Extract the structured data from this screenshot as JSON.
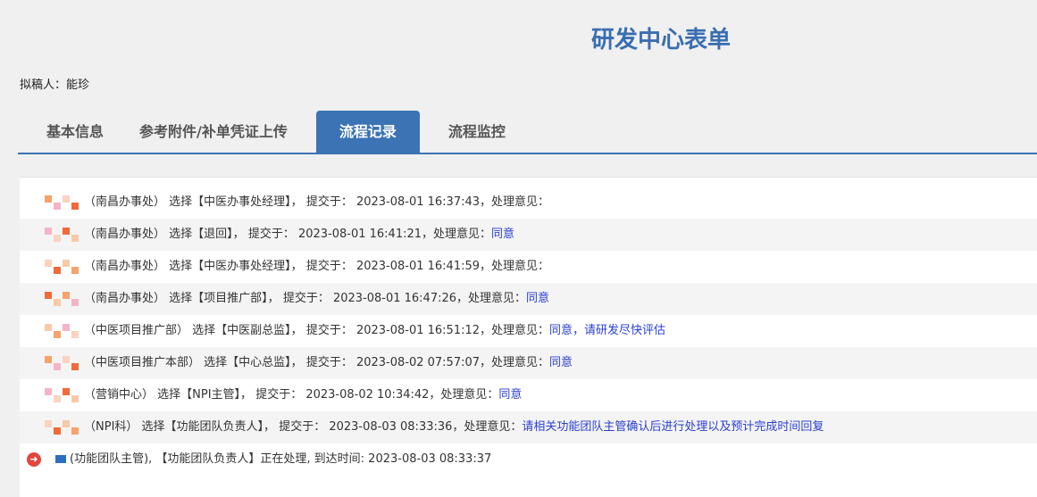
{
  "header": {
    "title": "研发中心表单",
    "drafter_label": "拟稿人：",
    "drafter": "能珍"
  },
  "tabs": [
    {
      "label": "基本信息"
    },
    {
      "label": "参考附件/补单凭证上传"
    },
    {
      "label": "流程记录",
      "active": true
    },
    {
      "label": "流程监控"
    }
  ],
  "records": [
    {
      "dept": "（南昌办事处）",
      "choice": "选择【中医办事处经理】，",
      "submit": "提交于： 2023-08-01 16:37:43，处理意见：",
      "opinion": ""
    },
    {
      "dept": "（南昌办事处）",
      "choice": "选择【退回】，",
      "submit": "提交于： 2023-08-01 16:41:21，处理意见：",
      "opinion": "同意"
    },
    {
      "dept": "（南昌办事处）",
      "choice": "选择【中医办事处经理】，",
      "submit": "提交于： 2023-08-01 16:41:59，处理意见：",
      "opinion": ""
    },
    {
      "dept": "（南昌办事处）",
      "choice": "选择【项目推广部】，",
      "submit": "提交于： 2023-08-01 16:47:26，处理意见：",
      "opinion": "同意"
    },
    {
      "dept": "（中医项目推广部）",
      "choice": "选择【中医副总监】，",
      "submit": "提交于： 2023-08-01 16:51:12，处理意见：",
      "opinion": "同意，请研发尽快评估"
    },
    {
      "dept": "（中医项目推广本部）",
      "choice": "选择【中心总监】，",
      "submit": "提交于： 2023-08-02 07:57:07，处理意见：",
      "opinion": "同意"
    },
    {
      "dept": "（营销中心）",
      "choice": "选择【NPI主管】，",
      "submit": "提交于： 2023-08-02 10:34:42，处理意见：",
      "opinion": "同意"
    },
    {
      "dept": "（NPI科）",
      "choice": "选择【功能团队负责人】，",
      "submit": "提交于： 2023-08-03 08:33:36，处理意见：",
      "opinion": "请相关功能团队主管确认后进行处理以及预计完成时间回复"
    }
  ],
  "current": {
    "text": "(功能团队主管), 【功能团队负责人】正在处理, 到达时间: 2023-08-03 08:33:37"
  },
  "colors": {
    "accent": "#3c73b4",
    "link": "#2a3fd0",
    "arrow": "#e2463c"
  }
}
